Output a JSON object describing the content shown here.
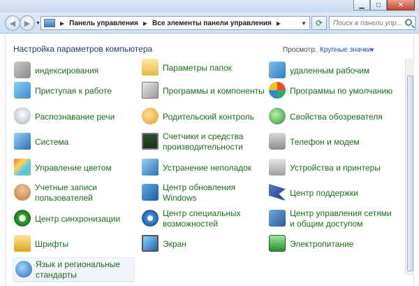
{
  "window": {
    "minimize_glyph": "▁",
    "maximize_glyph": "□",
    "close_glyph": "✕"
  },
  "nav": {
    "back_glyph": "◀",
    "forward_glyph": "▶",
    "history_glyph": "▼",
    "refresh_glyph": "⟳",
    "address_dropdown_glyph": "▼",
    "breadcrumb": [
      "Панель управления",
      "Все элементы панели управления"
    ],
    "breadcrumb_sep": "▶",
    "search_placeholder": "Поиск в панели упр..."
  },
  "header": {
    "title": "Настройка параметров компьютера",
    "view_label": "Просмотр:",
    "view_value": "Крупные значки",
    "view_arrow": "▼"
  },
  "items": {
    "index": "индексирования",
    "folder_options": "Параметры папок",
    "remote": "удаленным рабочим",
    "getting_started": "Приступая к работе",
    "programs": "Программы и компоненты",
    "default_programs": "Программы по умолчанию",
    "speech": "Распознавание речи",
    "parental": "Родительский контроль",
    "internet_options": "Свойства обозревателя",
    "system": "Система",
    "performance": "Счетчики и средства производительности",
    "phone_modem": "Телефон и модем",
    "color_management": "Управление цветом",
    "troubleshooting": "Устранение неполадок",
    "devices_printers": "Устройства и принтеры",
    "user_accounts": "Учетные записи пользователей",
    "windows_update": "Центр обновления Windows",
    "action_center": "Центр поддержки",
    "sync_center": "Центр синхронизации",
    "ease_of_access": "Центр специальных возможностей",
    "network_center": "Центр управления сетями и общим доступом",
    "fonts": "Шрифты",
    "display": "Экран",
    "power": "Электропитание",
    "region_language": "Язык и региональные стандарты"
  },
  "colors": {
    "link_green": "#1e6b1e",
    "heading_blue": "#1f3a57",
    "view_blue": "#1d4fa0"
  }
}
